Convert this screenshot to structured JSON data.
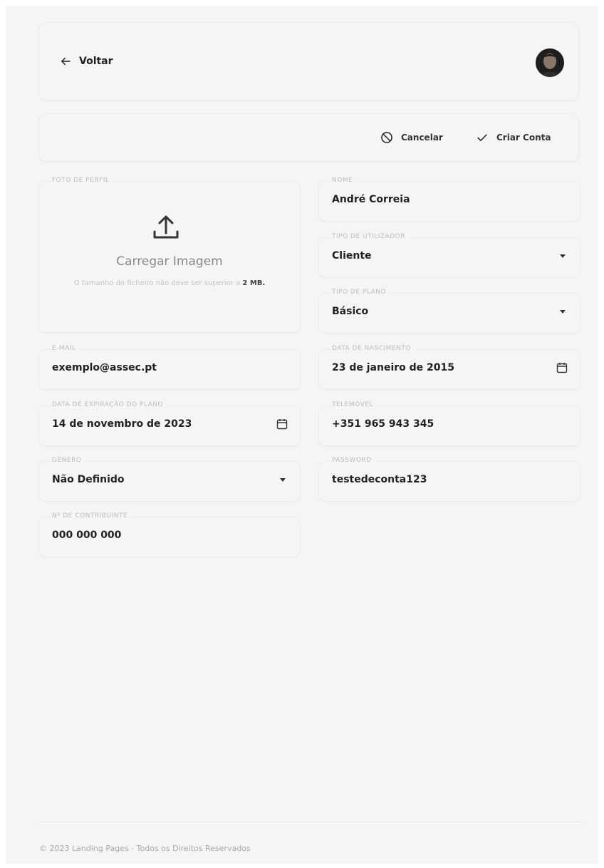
{
  "header": {
    "back_label": "Voltar"
  },
  "actions": {
    "cancel_label": "Cancelar",
    "create_label": "Criar Conta"
  },
  "profile_photo": {
    "label": "FOTO DE PERFIL",
    "upload_title": "Carregar Imagem",
    "hint_prefix": "O tamanho do ficheiro não deve ser superior a",
    "hint_size": "2 MB."
  },
  "fields": {
    "name": {
      "label": "NOME",
      "value": "André Correia"
    },
    "user_type": {
      "label": "TIPO DE UTILIZADOR",
      "value": "Cliente"
    },
    "plan_type": {
      "label": "TIPO DE PLANO",
      "value": "Básico"
    },
    "email": {
      "label": "E-MAIL",
      "value": "exemplo@assec.pt"
    },
    "birth_date": {
      "label": "DATA DE NASCIMENTO",
      "value": "23 de janeiro de 2015"
    },
    "plan_expiry": {
      "label": "DATA DE EXPIRAÇÃO DO PLANO",
      "value": "14 de novembro de 2023"
    },
    "phone": {
      "label": "TELEMÓVEL",
      "value": "+351 965 943 345"
    },
    "gender": {
      "label": "GÉNERO",
      "value": "Não Definido"
    },
    "password": {
      "label": "PASSWORD",
      "value": "testedeconta123"
    },
    "tax_number": {
      "label": "Nº DE CONTRIBUINTE",
      "value": "000 000 000"
    }
  },
  "footer": {
    "text": "© 2023 Landing Pages - Todos os Direitos Reservados"
  },
  "icons": {
    "back": "arrow-left-icon",
    "cancel": "ban-icon",
    "create": "check-icon",
    "upload": "upload-icon",
    "calendar": "calendar-icon",
    "dropdown": "caret-down-icon"
  }
}
